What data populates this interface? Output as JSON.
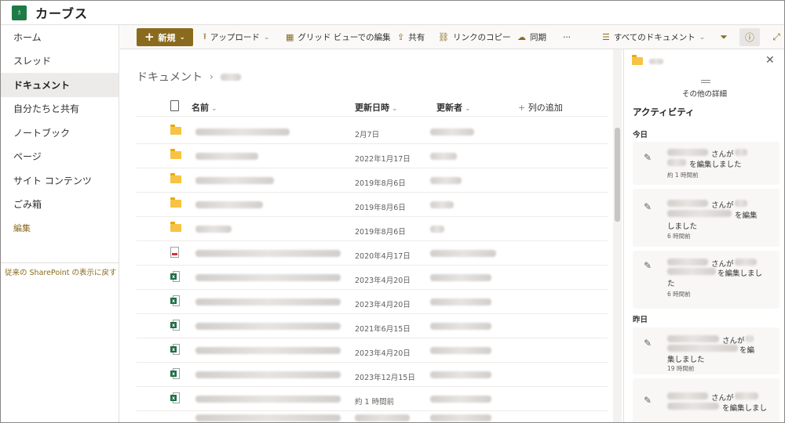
{
  "site": {
    "logo_text": "ｶ",
    "title": "カーブス"
  },
  "nav": {
    "items": [
      {
        "label": "ホーム",
        "selected": false
      },
      {
        "label": "スレッド",
        "selected": false
      },
      {
        "label": "ドキュメント",
        "selected": true
      },
      {
        "label": "自分たちと共有",
        "selected": false
      },
      {
        "label": "ノートブック",
        "selected": false
      },
      {
        "label": "ページ",
        "selected": false
      },
      {
        "label": "サイト コンテンツ",
        "selected": false
      },
      {
        "label": "ごみ箱",
        "selected": false
      }
    ],
    "edit_label": "編集",
    "classic_link": "従来の SharePoint の表示に戻す"
  },
  "commands": {
    "new": "新規",
    "upload": "アップロード",
    "grid_edit": "グリッド ビューでの編集",
    "share": "共有",
    "copy_link": "リンクのコピー",
    "sync": "同期",
    "more": "···",
    "view": "すべてのドキュメント"
  },
  "breadcrumb": {
    "root": "ドキュメント",
    "separator": "›"
  },
  "columns": {
    "name": "名前",
    "modified": "更新日時",
    "modified_by": "更新者",
    "add_column": "列の追加"
  },
  "rows": [
    {
      "type": "folder",
      "modified": "2月7日"
    },
    {
      "type": "folder",
      "modified": "2022年1月17日"
    },
    {
      "type": "folder",
      "modified": "2019年8月6日"
    },
    {
      "type": "folder",
      "modified": "2019年8月6日"
    },
    {
      "type": "folder",
      "modified": "2019年8月6日"
    },
    {
      "type": "pdf",
      "modified": "2020年4月17日"
    },
    {
      "type": "excel",
      "modified": "2023年4月20日"
    },
    {
      "type": "excel",
      "modified": "2023年4月20日"
    },
    {
      "type": "excel",
      "modified": "2021年6月15日"
    },
    {
      "type": "excel",
      "modified": "2023年4月20日"
    },
    {
      "type": "excel",
      "modified": "2023年12月15日"
    },
    {
      "type": "excel",
      "modified": "約 1 時間前"
    }
  ],
  "pane": {
    "more_details": "その他の詳細",
    "activity": "アクティビティ",
    "today": "今日",
    "yesterday": "昨日",
    "cards": [
      {
        "line1": "さんが",
        "line2": "を編集しました",
        "time": "約 1 時間前"
      },
      {
        "line1": "さんが",
        "line2": "を編集",
        "line3": "しました",
        "time": "6 時間前"
      },
      {
        "line1": "さんが",
        "line2": "を編集しまし",
        "line3": "た",
        "time": "6 時間前"
      },
      {
        "line1": "さんが",
        "line2": "を編",
        "line3": "集しました",
        "time": "19 時間前"
      },
      {
        "line1": "さんが",
        "line2": "を編集しまし"
      }
    ]
  },
  "colors": {
    "accent": "#8a6b1e",
    "site_logo": "#1e7b45",
    "excel": "#1d7044",
    "folder": "#f6c343"
  }
}
